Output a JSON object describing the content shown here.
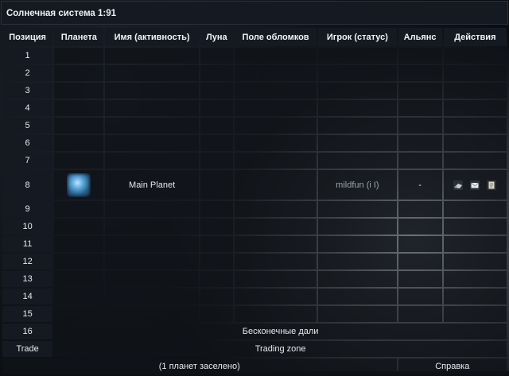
{
  "title": "Солнечная система 1:91",
  "headers": {
    "position": "Позиция",
    "planet": "Планета",
    "name": "Имя (активность)",
    "moon": "Луна",
    "debris": "Поле обломков",
    "player": "Игрок (статус)",
    "alliance": "Альянс",
    "actions": "Действия"
  },
  "rows": [
    {
      "pos": "1"
    },
    {
      "pos": "2"
    },
    {
      "pos": "3"
    },
    {
      "pos": "4"
    },
    {
      "pos": "5"
    },
    {
      "pos": "6"
    },
    {
      "pos": "7"
    },
    {
      "pos": "8",
      "name": "Main Planet",
      "player": "mildfun",
      "status": "(i I)",
      "alliance": "-"
    },
    {
      "pos": "9"
    },
    {
      "pos": "10"
    },
    {
      "pos": "11"
    },
    {
      "pos": "12"
    },
    {
      "pos": "13"
    },
    {
      "pos": "14"
    },
    {
      "pos": "15"
    }
  ],
  "row16": {
    "pos": "16",
    "text": "Бесконечные дали"
  },
  "trade": {
    "pos": "Trade",
    "text": "Trading zone"
  },
  "footer": {
    "colonized": "(1 планет заселено)",
    "help": "Справка"
  },
  "icons": {
    "planet": "planet-thumbnail",
    "action1": "spy-probe-icon",
    "action2": "message-envelope-icon",
    "action3": "buddy-request-icon"
  }
}
